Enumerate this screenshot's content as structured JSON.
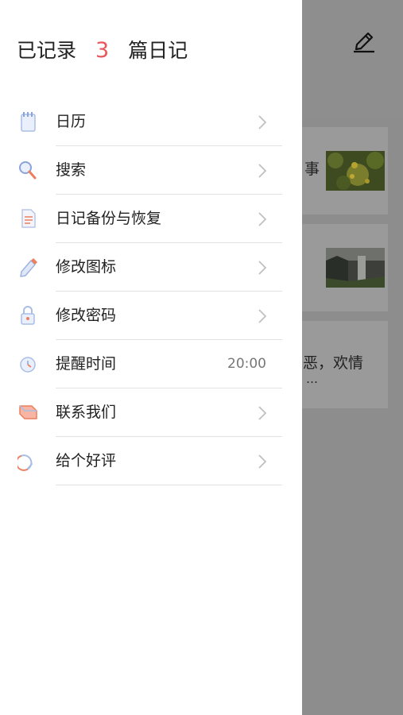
{
  "drawer": {
    "count_prefix": "已记录",
    "count": "3",
    "count_suffix": "篇日记",
    "items": [
      {
        "label": "日历",
        "icon": "notebook-icon"
      },
      {
        "label": "搜索",
        "icon": "search-icon"
      },
      {
        "label": "日记备份与恢复",
        "icon": "document-icon"
      },
      {
        "label": "修改图标",
        "icon": "pencil-icon"
      },
      {
        "label": "修改密码",
        "icon": "lock-icon"
      },
      {
        "label": "提醒时间",
        "icon": "clock-icon",
        "value": "20:00"
      },
      {
        "label": "联系我们",
        "icon": "contact-icon"
      },
      {
        "label": "给个好评",
        "icon": "like-icon"
      }
    ]
  },
  "background": {
    "entry1_snippet": "事",
    "entry3_snippet_line1": "恶，欢情",
    "entry3_snippet_line2": "…"
  },
  "colors": {
    "accent": "#e9575a",
    "overlay": "#8d8d8d"
  }
}
